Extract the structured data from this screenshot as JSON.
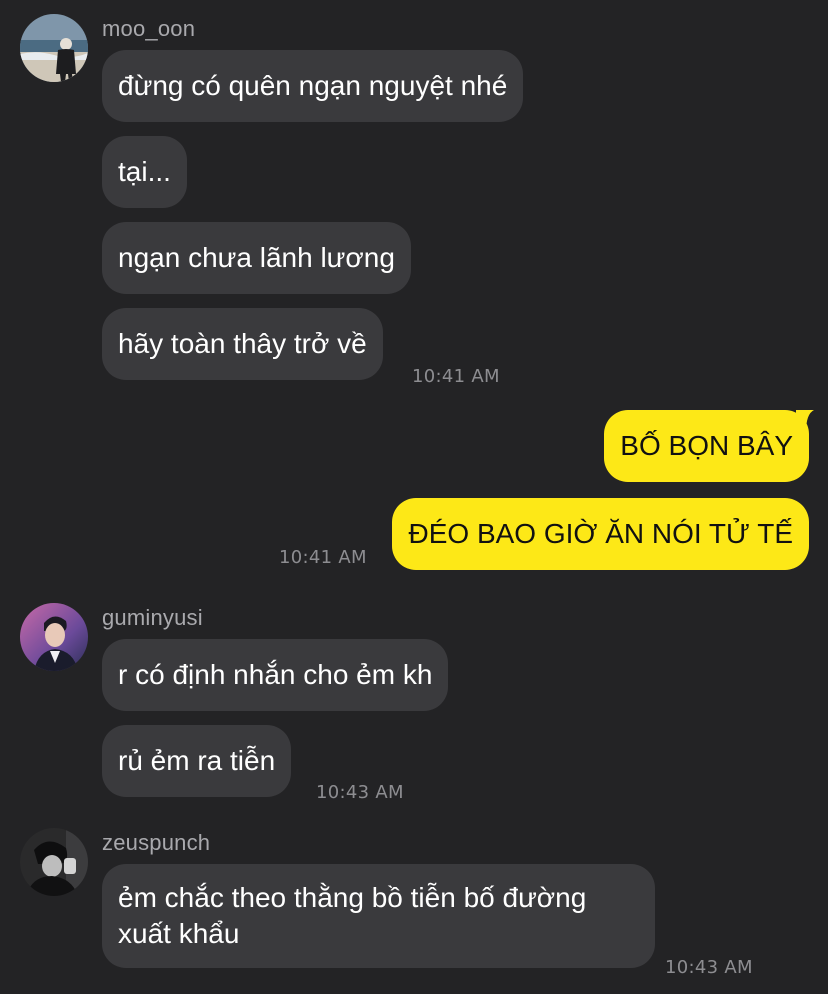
{
  "messages": {
    "g1": {
      "sender": "moo_oon",
      "m1": "đừng có quên ngạn nguyệt nhé",
      "m2": "tại...",
      "m3": "ngạn chưa lãnh lương",
      "m4": "hãy toàn thây trở về",
      "time": "10:41 AM"
    },
    "g2": {
      "m1": "BỐ BỌN BÂY",
      "m2": "ĐÉO BAO GIỜ ĂN NÓI TỬ TẾ",
      "time": "10:41 AM"
    },
    "g3": {
      "sender": "guminyusi",
      "m1": "r có định nhắn cho ẻm kh",
      "m2": "rủ ẻm ra tiễn",
      "time": "10:43 AM"
    },
    "g4": {
      "sender": "zeuspunch",
      "m1": "ẻm chắc theo thằng bồ tiễn bố đường xuất khẩu",
      "time": "10:43 AM"
    }
  },
  "colors": {
    "background": "#232325",
    "incoming_bubble": "#3a3a3d",
    "outgoing_bubble": "#fde817",
    "timestamp": "#8d8d91",
    "sender_name": "#a9a9ad"
  },
  "icons": {
    "avatar_moo_oon": "avatar-beach-photo",
    "avatar_guminyusi": "avatar-portrait-purple",
    "avatar_zeuspunch": "avatar-portrait-dark"
  }
}
